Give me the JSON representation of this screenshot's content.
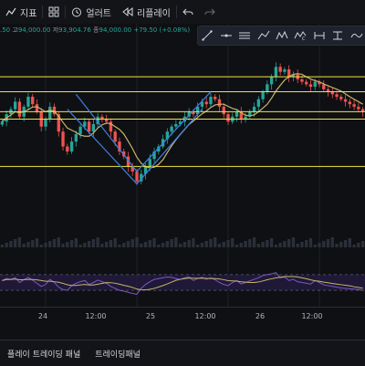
{
  "toolbar": {
    "indicators_label": "지표",
    "alerts_label": "얼러트",
    "replay_label": "리플레이",
    "icons": [
      "chart-type-icon",
      "indicators-icon",
      "templates-icon",
      "alert-icon",
      "replay-icon",
      "undo-icon",
      "redo-icon"
    ]
  },
  "legend": {
    "open_partial": ".50",
    "high_label": "고",
    "high_value": "94,000.00",
    "low_label": "저",
    "low_value": "93,904.76",
    "close_label": "종",
    "close_value": "94,000.00",
    "change": "+79.50 (+0.08%)"
  },
  "drawing_tools": [
    "trend-line-icon",
    "horizontal-ray-icon",
    "parallel-channel-icon",
    "pitchfork-icon",
    "xabcd-pattern-icon",
    "elliott-wave-icon",
    "date-range-icon",
    "price-range-icon",
    "brush-icon"
  ],
  "time_axis": [
    "24",
    "12:00",
    "25",
    "12:00",
    "26",
    "12:00"
  ],
  "bottom_tabs": [
    "플레이 트레이딩 패널",
    "트레이딩패널"
  ],
  "colors": {
    "background": "#0f1013",
    "level_line": "#f0e442",
    "channel_line": "#3d7fe0",
    "ma_line": "#c7b46a",
    "rsi_line": "#7e57c2",
    "rsi_band": "#2a2050",
    "candle_up": "#26a69a",
    "candle_down": "#ef5350"
  },
  "chart_data": {
    "type": "candlestick",
    "horizontal_levels": [
      93800,
      93500,
      93100,
      92950,
      92000
    ],
    "ylim": [
      91200,
      94500
    ],
    "series_close": [
      92900,
      93050,
      93150,
      93300,
      93000,
      93200,
      93400,
      93250,
      93100,
      92800,
      92950,
      93200,
      93050,
      92700,
      92400,
      92300,
      92500,
      92650,
      92800,
      92900,
      92700,
      92850,
      93000,
      92950,
      92900,
      92700,
      92500,
      92300,
      92200,
      92000,
      91900,
      91700,
      91850,
      92000,
      92150,
      92300,
      92400,
      92550,
      92700,
      92800,
      92850,
      92900,
      93000,
      93100,
      93050,
      93200,
      93300,
      93250,
      93400,
      93350,
      93200,
      93050,
      92900,
      93000,
      93100,
      92950,
      93000,
      93100,
      93200,
      93350,
      93500,
      93650,
      93800,
      94000,
      93900,
      93950,
      93800,
      93850,
      93750,
      93700,
      93650,
      93600,
      93700,
      93650,
      93550,
      93500,
      93450,
      93400,
      93350,
      93300,
      93250,
      93200,
      93150,
      93100
    ],
    "rsi": [
      55,
      60,
      58,
      62,
      50,
      57,
      63,
      56,
      48,
      40,
      45,
      58,
      50,
      38,
      32,
      30,
      42,
      48,
      52,
      55,
      45,
      50,
      56,
      52,
      48,
      40,
      35,
      30,
      28,
      25,
      22,
      20,
      35,
      45,
      52,
      58,
      60,
      62,
      64,
      63,
      60,
      58,
      62,
      64,
      55,
      60,
      63,
      58,
      62,
      57,
      50,
      45,
      42,
      50,
      55,
      46,
      50,
      54,
      58,
      62,
      68,
      70,
      72,
      75,
      62,
      64,
      55,
      58,
      52,
      50,
      48,
      46,
      55,
      50,
      44,
      42,
      40,
      38,
      36,
      35,
      34,
      33,
      32,
      30
    ],
    "rsi_levels": [
      70,
      30
    ]
  }
}
